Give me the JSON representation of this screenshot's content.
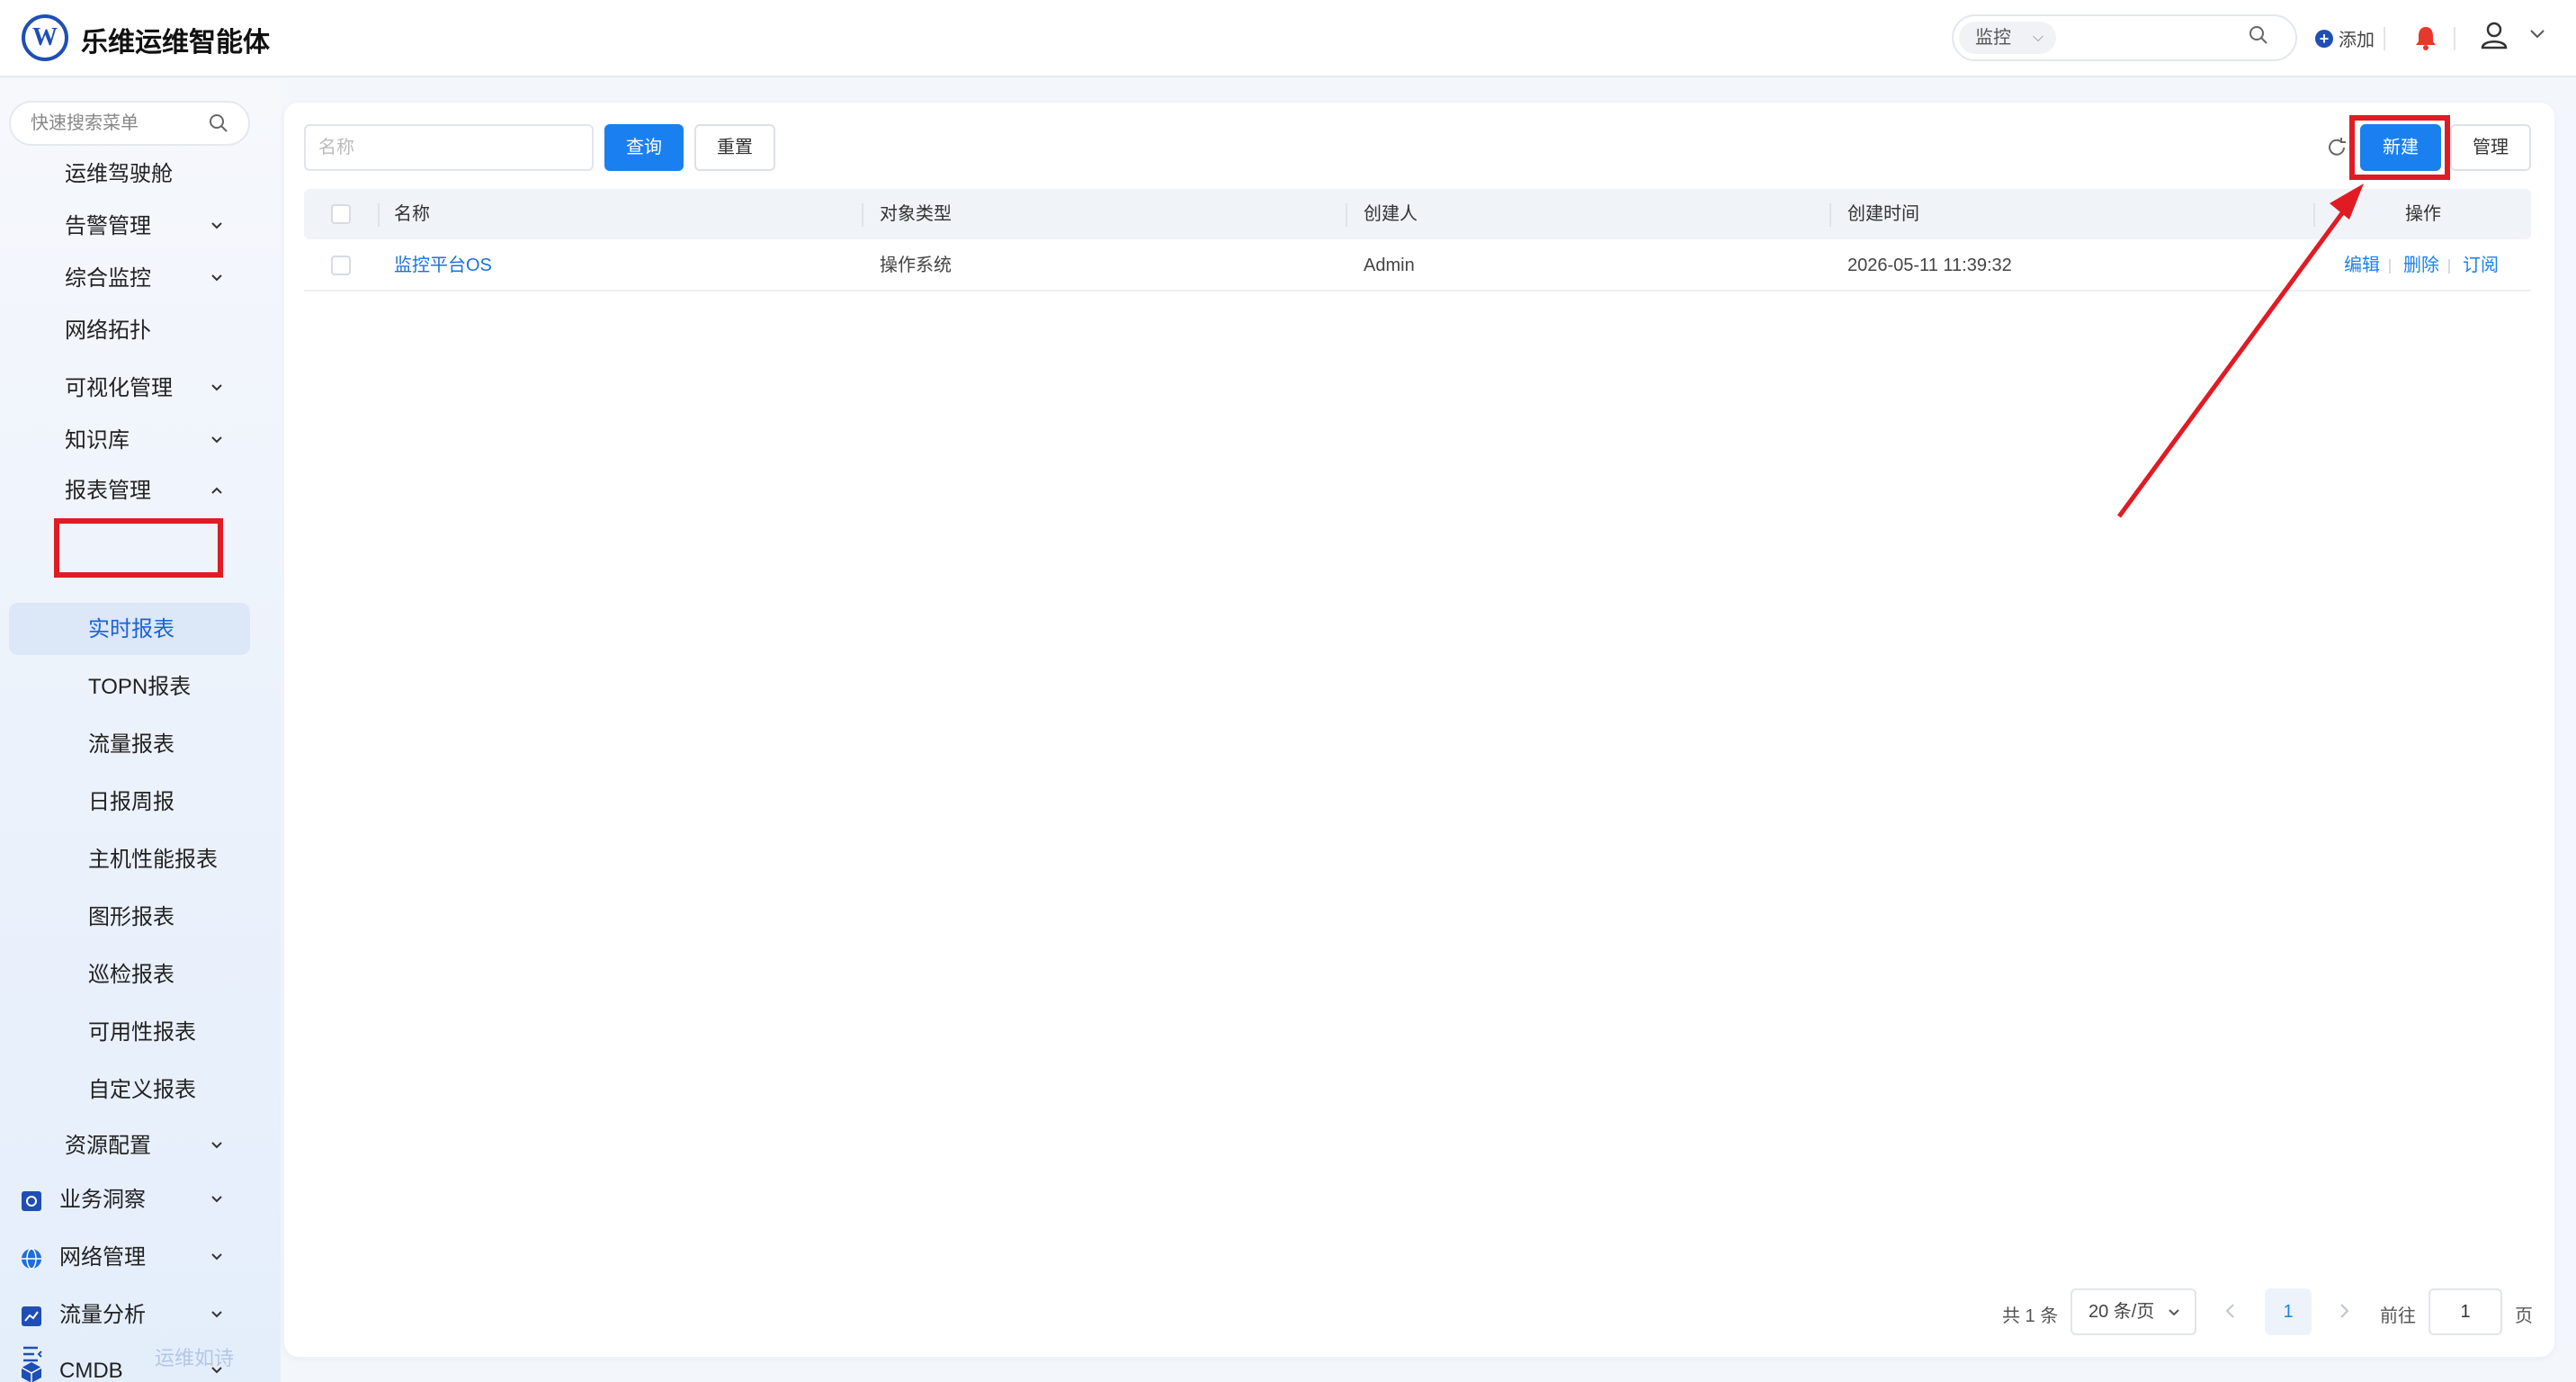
{
  "header": {
    "logo_text": "W",
    "title": "乐维运维智能体",
    "search_scope": "监控",
    "add_label": "添加",
    "icons": [
      "search-icon",
      "plus-icon",
      "bell-icon",
      "user-icon",
      "chevron-down-icon"
    ],
    "bell_color": "#e8372c"
  },
  "sidebar": {
    "search_placeholder": "快速搜索菜单",
    "items": [
      {
        "label": "运维驾驶舱"
      },
      {
        "label": "告警管理"
      },
      {
        "label": "综合监控"
      },
      {
        "label": "网络拓扑"
      },
      {
        "label": "可视化管理"
      },
      {
        "label": "知识库"
      },
      {
        "label": "报表管理"
      }
    ],
    "report_sub": [
      {
        "label": "实时报表",
        "active": true
      },
      {
        "label": "TOPN报表"
      },
      {
        "label": "流量报表"
      },
      {
        "label": "日报周报"
      },
      {
        "label": "主机性能报表"
      },
      {
        "label": "图形报表"
      },
      {
        "label": "巡检报表"
      },
      {
        "label": "可用性报表"
      },
      {
        "label": "自定义报表"
      }
    ],
    "after": [
      {
        "label": "资源配置"
      }
    ],
    "top_groups": [
      {
        "label": "业务洞察",
        "icon": "business-insight-icon"
      },
      {
        "label": "网络管理",
        "icon": "globe-icon"
      },
      {
        "label": "流量分析",
        "icon": "traffic-chart-icon"
      },
      {
        "label": "CMDB",
        "icon": "cube-icon"
      }
    ],
    "footer_text": "运维如诗"
  },
  "toolbar": {
    "name_placeholder": "名称",
    "query_label": "查询",
    "reset_label": "重置",
    "new_label": "新建",
    "manage_label": "管理"
  },
  "table": {
    "columns": [
      "名称",
      "对象类型",
      "创建人",
      "创建时间",
      "操作"
    ],
    "rows": [
      {
        "name": "监控平台OS",
        "type": "操作系统",
        "creator": "Admin",
        "created": "2026-05-11 11:39:32"
      }
    ],
    "actions": [
      "编辑",
      "删除",
      "订阅"
    ]
  },
  "pagination": {
    "total": "共 1 条",
    "page_size": "20 条/页",
    "current_page": "1",
    "goto_label": "前往",
    "goto_value": "1",
    "unit": "页"
  },
  "colors": {
    "accent": "#1a80f0",
    "highlight": "#e01b24"
  }
}
